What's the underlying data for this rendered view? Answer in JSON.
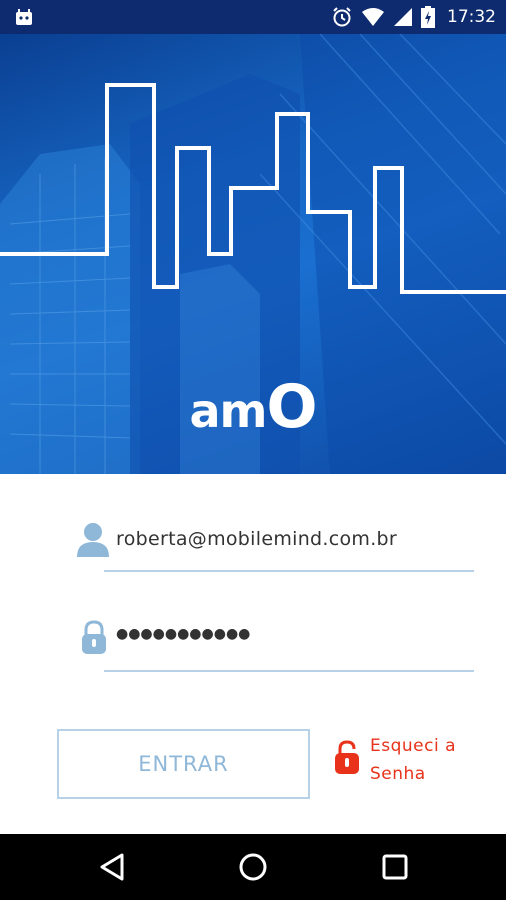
{
  "status_bar": {
    "time": "17:32",
    "icons": [
      "android-icon",
      "alarm-icon",
      "wifi-icon",
      "signal-icon",
      "battery-icon"
    ]
  },
  "hero": {
    "logo_text_small": "am",
    "logo_text_big": "O"
  },
  "login": {
    "email_value": "roberta@mobilemind.com.br",
    "password_value": "●●●●●●●●●●●",
    "submit_label": "ENTRAR",
    "forgot_line1": "Esqueci a",
    "forgot_line2": "Senha"
  },
  "colors": {
    "brand_blue": "#1a6fd0",
    "accent_red": "#e8321a",
    "field_icon": "#8eb7d8"
  }
}
